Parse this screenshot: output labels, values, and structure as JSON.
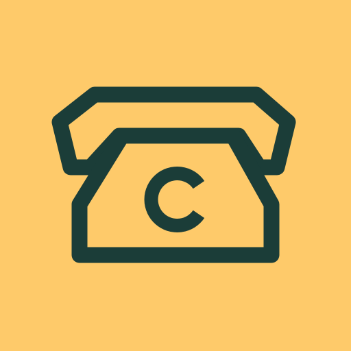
{
  "logo": {
    "name": "telephone-c-logo",
    "letter": "c",
    "colors": {
      "background": "#FECA6A",
      "foreground": "#1B3D38"
    }
  }
}
